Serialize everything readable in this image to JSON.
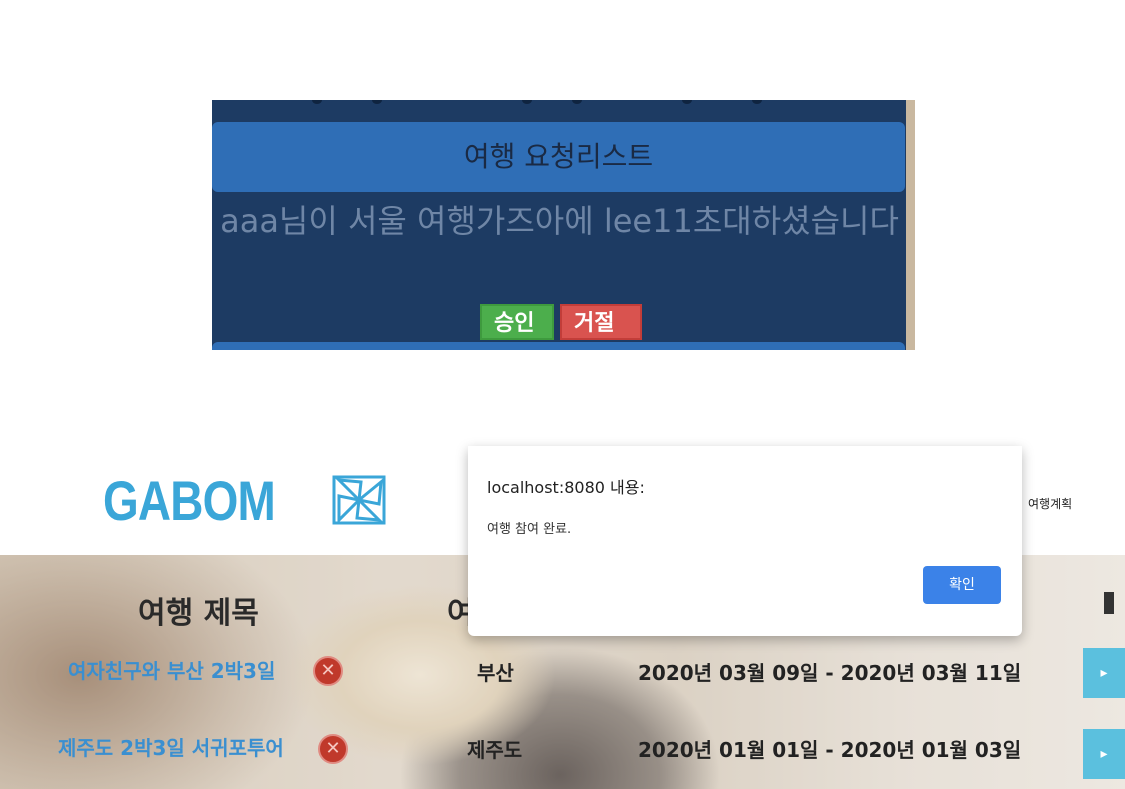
{
  "panel": {
    "header": "여행 요청리스트",
    "message": "aaa님이 서울 여행가즈아에 lee11초대하셨습니다",
    "approve_label": "승인",
    "reject_label": "거절"
  },
  "site": {
    "logo_text": "GABOM",
    "logo_icon": "pinwheel-icon",
    "nav_item": "여행계획"
  },
  "table": {
    "col_title": "여행 제목",
    "col_dest": "여",
    "rows": [
      {
        "title": "여자친구와 부산 2박3일",
        "dest": "부산",
        "date": "2020년 03월 09일 - 2020년 03월 11일"
      },
      {
        "title": "제주도 2박3일 서귀포투어",
        "dest": "제주도",
        "date": "2020년 01월 01일 - 2020년 01월 03일"
      }
    ]
  },
  "dialog": {
    "title": "localhost:8080 내용:",
    "message": "여행 참여 완료.",
    "ok_label": "확인"
  },
  "colors": {
    "accent": "#3aa6d8",
    "approve": "#4cae4c",
    "reject": "#d9534f",
    "dialog_button": "#3b82e8"
  }
}
